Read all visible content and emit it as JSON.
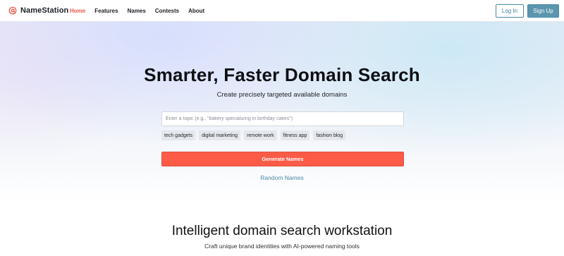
{
  "brand": {
    "name": "NameStation",
    "icon": "at-sign-icon",
    "accent_color": "#f05a47"
  },
  "nav": {
    "items": [
      {
        "label": "Home",
        "active": true
      },
      {
        "label": "Features",
        "active": false
      },
      {
        "label": "Names",
        "active": false
      },
      {
        "label": "Contests",
        "active": false
      },
      {
        "label": "About",
        "active": false
      }
    ]
  },
  "auth": {
    "login_label": "Log In",
    "signup_label": "Sign Up",
    "button_color": "#5b95ae"
  },
  "hero": {
    "title": "Smarter, Faster Domain Search",
    "subtitle": "Create precisely targeted available domains",
    "search_placeholder": "Enter a topic (e.g., \"bakery specializing in birthday cakes\")",
    "search_value": "",
    "suggestions": [
      "tech gadgets",
      "digital marketing",
      "remote work",
      "fitness app",
      "fashion blog"
    ],
    "generate_label": "Generate Names",
    "generate_color": "#fb5b47",
    "random_label": "Random Names"
  },
  "section": {
    "title": "Intelligent domain search workstation",
    "subtitle": "Craft unique brand identities with AI-powered naming tools"
  }
}
